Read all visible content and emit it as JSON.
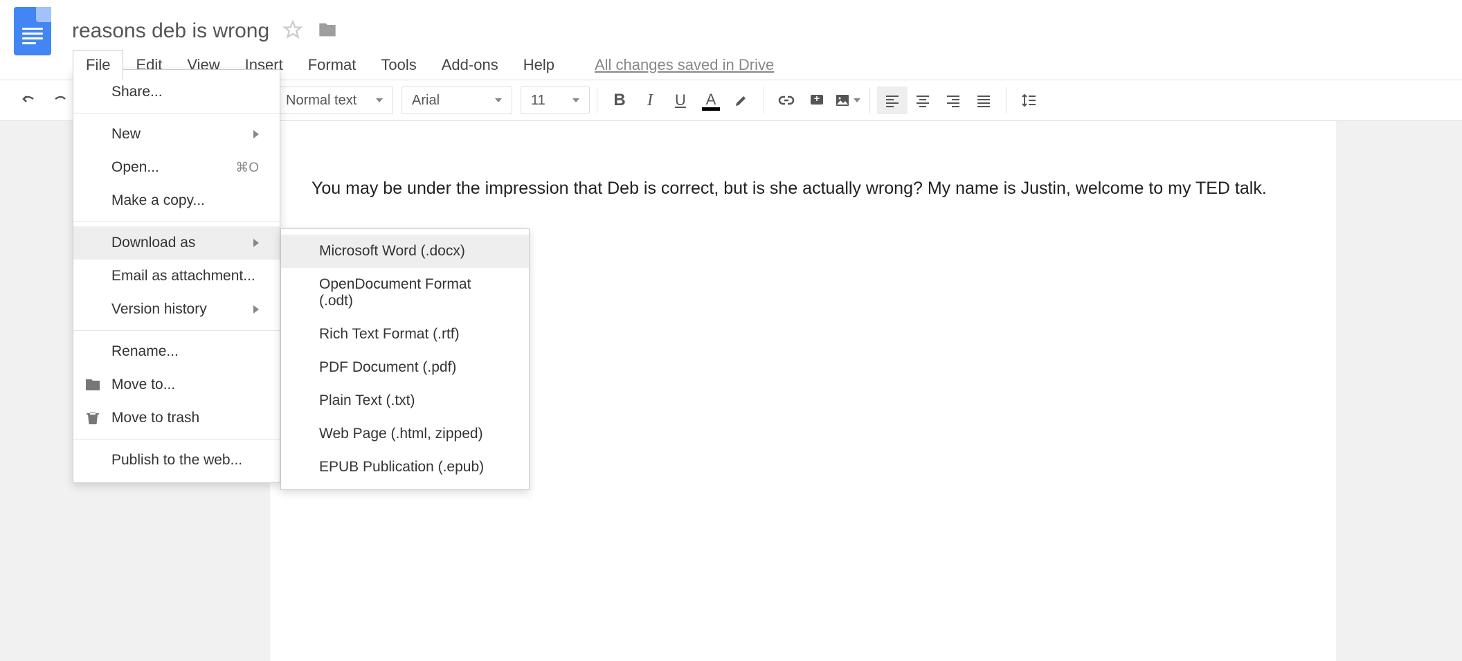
{
  "header": {
    "title": "reasons deb is wrong",
    "save_status": "All changes saved in Drive"
  },
  "menubar": {
    "file": "File",
    "edit": "Edit",
    "view": "View",
    "insert": "Insert",
    "format": "Format",
    "tools": "Tools",
    "addons": "Add-ons",
    "help": "Help"
  },
  "toolbar": {
    "style": "Normal text",
    "font": "Arial",
    "size": "11"
  },
  "file_menu": {
    "share": "Share...",
    "new": "New",
    "open": "Open...",
    "open_shortcut": "⌘O",
    "make_a_copy": "Make a copy...",
    "download_as": "Download as",
    "email_attachment": "Email as attachment...",
    "version_history": "Version history",
    "rename": "Rename...",
    "move_to": "Move to...",
    "move_to_trash": "Move to trash",
    "publish_web": "Publish to the web..."
  },
  "download_submenu": {
    "docx": "Microsoft Word (.docx)",
    "odt": "OpenDocument Format (.odt)",
    "rtf": "Rich Text Format (.rtf)",
    "pdf": "PDF Document (.pdf)",
    "txt": "Plain Text (.txt)",
    "html": "Web Page (.html, zipped)",
    "epub": "EPUB Publication (.epub)"
  },
  "document": {
    "body": "You may be under the impression that Deb is correct, but is she actually wrong? My name is Justin, welcome to my TED talk."
  }
}
